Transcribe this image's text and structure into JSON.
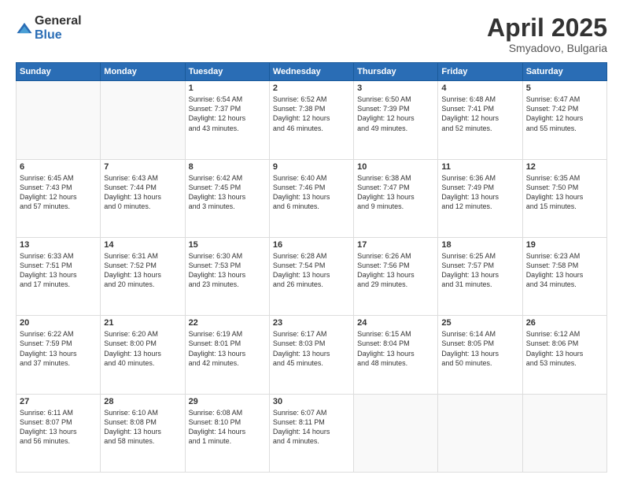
{
  "logo": {
    "general": "General",
    "blue": "Blue"
  },
  "header": {
    "month": "April 2025",
    "location": "Smyadovo, Bulgaria"
  },
  "days_of_week": [
    "Sunday",
    "Monday",
    "Tuesday",
    "Wednesday",
    "Thursday",
    "Friday",
    "Saturday"
  ],
  "weeks": [
    [
      {
        "day": "",
        "content": ""
      },
      {
        "day": "",
        "content": ""
      },
      {
        "day": "1",
        "content": "Sunrise: 6:54 AM\nSunset: 7:37 PM\nDaylight: 12 hours\nand 43 minutes."
      },
      {
        "day": "2",
        "content": "Sunrise: 6:52 AM\nSunset: 7:38 PM\nDaylight: 12 hours\nand 46 minutes."
      },
      {
        "day": "3",
        "content": "Sunrise: 6:50 AM\nSunset: 7:39 PM\nDaylight: 12 hours\nand 49 minutes."
      },
      {
        "day": "4",
        "content": "Sunrise: 6:48 AM\nSunset: 7:41 PM\nDaylight: 12 hours\nand 52 minutes."
      },
      {
        "day": "5",
        "content": "Sunrise: 6:47 AM\nSunset: 7:42 PM\nDaylight: 12 hours\nand 55 minutes."
      }
    ],
    [
      {
        "day": "6",
        "content": "Sunrise: 6:45 AM\nSunset: 7:43 PM\nDaylight: 12 hours\nand 57 minutes."
      },
      {
        "day": "7",
        "content": "Sunrise: 6:43 AM\nSunset: 7:44 PM\nDaylight: 13 hours\nand 0 minutes."
      },
      {
        "day": "8",
        "content": "Sunrise: 6:42 AM\nSunset: 7:45 PM\nDaylight: 13 hours\nand 3 minutes."
      },
      {
        "day": "9",
        "content": "Sunrise: 6:40 AM\nSunset: 7:46 PM\nDaylight: 13 hours\nand 6 minutes."
      },
      {
        "day": "10",
        "content": "Sunrise: 6:38 AM\nSunset: 7:47 PM\nDaylight: 13 hours\nand 9 minutes."
      },
      {
        "day": "11",
        "content": "Sunrise: 6:36 AM\nSunset: 7:49 PM\nDaylight: 13 hours\nand 12 minutes."
      },
      {
        "day": "12",
        "content": "Sunrise: 6:35 AM\nSunset: 7:50 PM\nDaylight: 13 hours\nand 15 minutes."
      }
    ],
    [
      {
        "day": "13",
        "content": "Sunrise: 6:33 AM\nSunset: 7:51 PM\nDaylight: 13 hours\nand 17 minutes."
      },
      {
        "day": "14",
        "content": "Sunrise: 6:31 AM\nSunset: 7:52 PM\nDaylight: 13 hours\nand 20 minutes."
      },
      {
        "day": "15",
        "content": "Sunrise: 6:30 AM\nSunset: 7:53 PM\nDaylight: 13 hours\nand 23 minutes."
      },
      {
        "day": "16",
        "content": "Sunrise: 6:28 AM\nSunset: 7:54 PM\nDaylight: 13 hours\nand 26 minutes."
      },
      {
        "day": "17",
        "content": "Sunrise: 6:26 AM\nSunset: 7:56 PM\nDaylight: 13 hours\nand 29 minutes."
      },
      {
        "day": "18",
        "content": "Sunrise: 6:25 AM\nSunset: 7:57 PM\nDaylight: 13 hours\nand 31 minutes."
      },
      {
        "day": "19",
        "content": "Sunrise: 6:23 AM\nSunset: 7:58 PM\nDaylight: 13 hours\nand 34 minutes."
      }
    ],
    [
      {
        "day": "20",
        "content": "Sunrise: 6:22 AM\nSunset: 7:59 PM\nDaylight: 13 hours\nand 37 minutes."
      },
      {
        "day": "21",
        "content": "Sunrise: 6:20 AM\nSunset: 8:00 PM\nDaylight: 13 hours\nand 40 minutes."
      },
      {
        "day": "22",
        "content": "Sunrise: 6:19 AM\nSunset: 8:01 PM\nDaylight: 13 hours\nand 42 minutes."
      },
      {
        "day": "23",
        "content": "Sunrise: 6:17 AM\nSunset: 8:03 PM\nDaylight: 13 hours\nand 45 minutes."
      },
      {
        "day": "24",
        "content": "Sunrise: 6:15 AM\nSunset: 8:04 PM\nDaylight: 13 hours\nand 48 minutes."
      },
      {
        "day": "25",
        "content": "Sunrise: 6:14 AM\nSunset: 8:05 PM\nDaylight: 13 hours\nand 50 minutes."
      },
      {
        "day": "26",
        "content": "Sunrise: 6:12 AM\nSunset: 8:06 PM\nDaylight: 13 hours\nand 53 minutes."
      }
    ],
    [
      {
        "day": "27",
        "content": "Sunrise: 6:11 AM\nSunset: 8:07 PM\nDaylight: 13 hours\nand 56 minutes."
      },
      {
        "day": "28",
        "content": "Sunrise: 6:10 AM\nSunset: 8:08 PM\nDaylight: 13 hours\nand 58 minutes."
      },
      {
        "day": "29",
        "content": "Sunrise: 6:08 AM\nSunset: 8:10 PM\nDaylight: 14 hours\nand 1 minute."
      },
      {
        "day": "30",
        "content": "Sunrise: 6:07 AM\nSunset: 8:11 PM\nDaylight: 14 hours\nand 4 minutes."
      },
      {
        "day": "",
        "content": ""
      },
      {
        "day": "",
        "content": ""
      },
      {
        "day": "",
        "content": ""
      }
    ]
  ]
}
